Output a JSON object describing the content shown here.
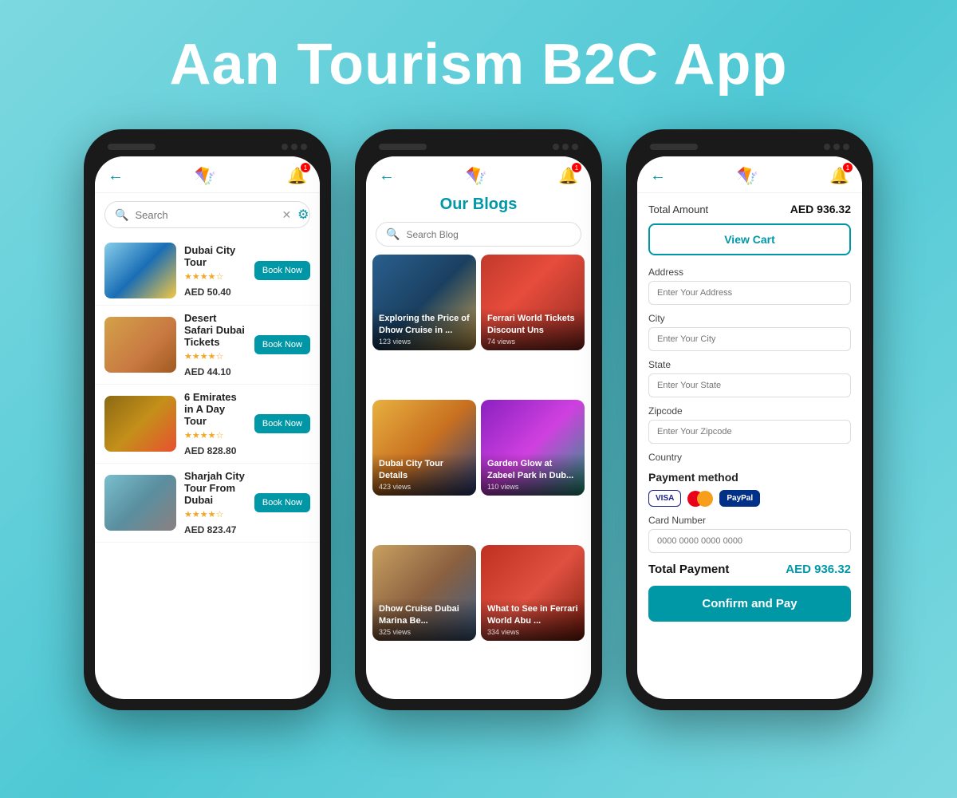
{
  "page": {
    "title": "Aan Tourism B2C App",
    "bg_color": "#6ecfd8"
  },
  "phone1": {
    "search_placeholder": "Search",
    "tours": [
      {
        "name": "Dubai City Tour",
        "stars": 4,
        "price": "AED 50.40",
        "book_label": "Book Now",
        "img_class": "img-dubai-city"
      },
      {
        "name": "Desert Safari Dubai Tickets",
        "stars": 4,
        "price": "AED 44.10",
        "book_label": "Book Now",
        "img_class": "img-desert"
      },
      {
        "name": "6 Emirates in A Day Tour",
        "stars": 4,
        "price": "AED 828.80",
        "book_label": "Book Now",
        "img_class": "img-emirates"
      },
      {
        "name": "Sharjah City Tour From Dubai",
        "stars": 4,
        "price": "AED 823.47",
        "book_label": "Book Now",
        "img_class": "img-sharjah"
      }
    ]
  },
  "phone2": {
    "title_plain": "Our ",
    "title_colored": "Blogs",
    "search_placeholder": "Search Blog",
    "blogs": [
      {
        "title": "Exploring the Price of Dhow Cruise in ...",
        "views": "123 views",
        "img_class": "img-dhow"
      },
      {
        "title": "Ferrari World Tickets Discount Uns",
        "views": "74 views",
        "img_class": "img-ferrari"
      },
      {
        "title": "Dubai City Tour Details",
        "views": "423 views",
        "img_class": "img-dubai-tour"
      },
      {
        "title": "Garden Glow at Zabeel Park in Dub...",
        "views": "110 views",
        "img_class": "img-garden"
      },
      {
        "title": "Dhow Cruise Dubai Marina Be...",
        "views": "325 views",
        "img_class": "img-dhow-marina"
      },
      {
        "title": "What to See in Ferrari World Abu ...",
        "views": "334 views",
        "img_class": "img-ferrari-world"
      }
    ]
  },
  "phone3": {
    "total_amount_label": "Total Amount",
    "total_amount_value": "AED 936.32",
    "view_cart_label": "View Cart",
    "address_label": "Address",
    "address_placeholder": "Enter Your Address",
    "city_label": "City",
    "city_placeholder": "Enter Your City",
    "state_label": "State",
    "state_placeholder": "Enter Your State",
    "zipcode_label": "Zipcode",
    "zipcode_placeholder": "Enter Your Zipcode",
    "country_label": "Country",
    "payment_label": "Payment method",
    "card_number_label": "Card Number",
    "card_number_placeholder": "0000 0000 0000 0000",
    "total_payment_label": "Total Payment",
    "total_payment_value": "AED 936.32",
    "confirm_label": "Confirm and Pay"
  }
}
